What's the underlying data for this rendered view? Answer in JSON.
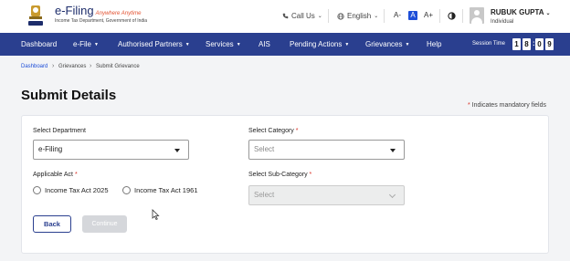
{
  "header": {
    "logo_title": "e-Filing",
    "logo_tagline": "Anywhere Anytime",
    "logo_subtitle": "Income Tax Department, Government of India",
    "call_us": "Call Us",
    "language": "English",
    "font_decrease": "A-",
    "font_normal": "A",
    "font_increase": "A+",
    "contrast_icon": "contrast-icon",
    "user_name": "RUBUK GUPTA",
    "user_role": "Individual"
  },
  "nav": {
    "items": [
      "Dashboard",
      "e-File",
      "Authorised Partners",
      "Services",
      "AIS",
      "Pending Actions",
      "Grievances",
      "Help"
    ],
    "session_label": "Session Time",
    "session_digits": [
      "1",
      "8",
      "0",
      "9"
    ]
  },
  "breadcrumb": [
    "Dashboard",
    "Grievances",
    "Submit Grievance"
  ],
  "page": {
    "title": "Submit Details",
    "mandatory_note": "Indicates mandatory fields"
  },
  "form": {
    "department_label": "Select Department",
    "department_value": "e-Filing",
    "category_label": "Select Category",
    "category_placeholder": "Select",
    "act_label": "Applicable Act",
    "act_options": [
      "Income Tax Act 2025",
      "Income Tax Act 1961"
    ],
    "subcategory_label": "Select Sub-Category",
    "subcategory_placeholder": "Select",
    "back_label": "Back",
    "continue_label": "Continue"
  },
  "colors": {
    "nav_bg": "#2a3f8f",
    "link": "#1d4ed8",
    "required": "#d93025"
  }
}
